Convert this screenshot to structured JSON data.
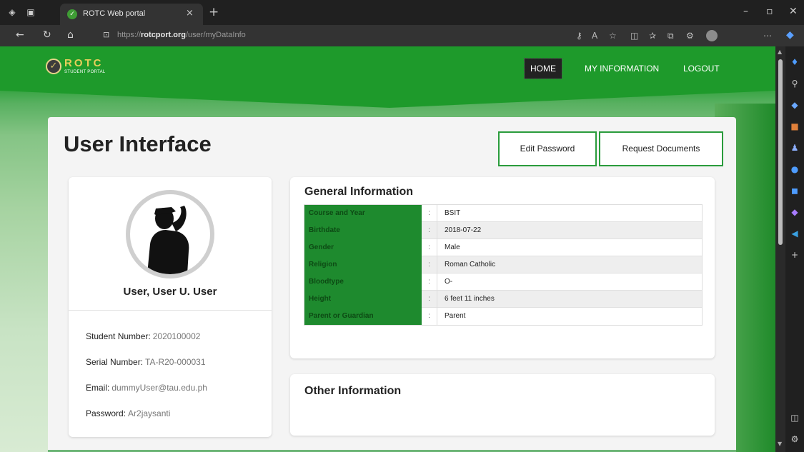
{
  "browser": {
    "tab_title": "ROTC Web portal",
    "tab_close": "×",
    "new_tab": "+",
    "url_prefix": "https://",
    "url_domain": "rotcport.org",
    "url_path": "/user/myDataInfo",
    "window_controls": {
      "minimize": "–",
      "restore": "▫",
      "close": "✕"
    }
  },
  "site": {
    "logo_word": "ROTC",
    "logo_sub": "STUDENT PORTAL",
    "nav": {
      "home": "HOME",
      "info": "MY INFORMATION",
      "logout": "LOGOUT"
    }
  },
  "page": {
    "title": "User Interface",
    "buttons": {
      "edit_password": "Edit Password",
      "request_documents": "Request Documents"
    }
  },
  "profile": {
    "name": "User, User U. User",
    "student_number_label": "Student Number:",
    "student_number": "2020100002",
    "serial_number_label": "Serial Number:",
    "serial_number": "TA-R20-000031",
    "email_label": "Email:",
    "email": "dummyUser@tau.edu.ph",
    "password_label": "Password:",
    "password": "Ar2jaysanti"
  },
  "general": {
    "title": "General Information",
    "separator": ":",
    "rows": [
      {
        "key": "Course and Year",
        "value": "BSIT"
      },
      {
        "key": "Birthdate",
        "value": "2018-07-22"
      },
      {
        "key": "Gender",
        "value": "Male"
      },
      {
        "key": "Religion",
        "value": "Roman Catholic"
      },
      {
        "key": "Bloodtype",
        "value": "O-"
      },
      {
        "key": "Height",
        "value": "6 feet 11 inches"
      },
      {
        "key": "Parent or Guardian",
        "value": "Parent"
      }
    ]
  },
  "other": {
    "title": "Other Information"
  },
  "colors": {
    "brand_green": "#1e9a2b",
    "table_key_green": "#1e8a2e",
    "button_border": "#2a9c3c"
  }
}
